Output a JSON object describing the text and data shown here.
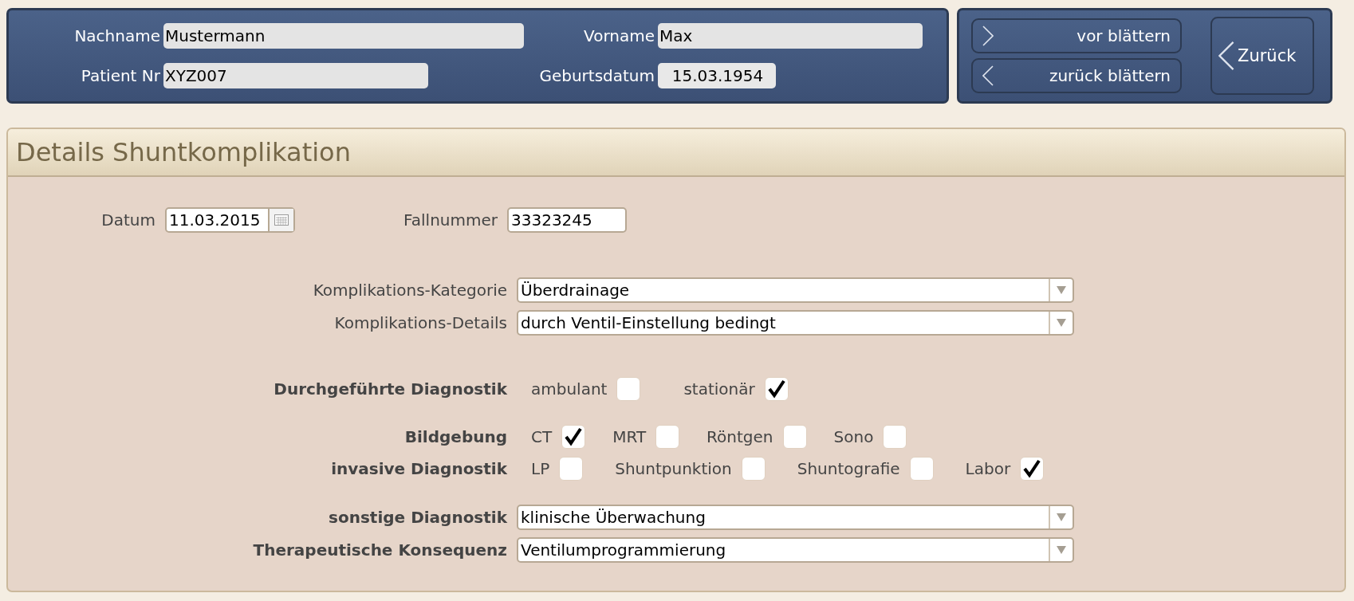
{
  "patient": {
    "fields": [
      {
        "label": "Nachname",
        "value": "Mustermann"
      },
      {
        "label": "Vorname",
        "value": "Max"
      },
      {
        "label": "Patient Nr",
        "value": "XYZ007"
      },
      {
        "label": "Geburtsdatum",
        "value": "15.03.1954"
      }
    ]
  },
  "navigation": {
    "buttons": [
      {
        "label": "vor blättern",
        "kind": "forward"
      },
      {
        "label": "zurück blättern",
        "kind": "backward"
      }
    ],
    "back": {
      "label": "Zurück",
      "kind": "backward"
    }
  },
  "section": {
    "title": "Details Shuntkomplikation",
    "date": {
      "label": "Datum",
      "value": "11.03.2015"
    },
    "case_number": {
      "label": "Fallnummer",
      "value": "33323245"
    },
    "complication_selects": [
      {
        "label": "Komplikations-Kategorie",
        "value": "Überdrainage"
      },
      {
        "label": "Komplikations-Details",
        "value": "durch Ventil-Einstellung bedingt"
      }
    ],
    "checkbox_groups": [
      {
        "label": "Durchgeführte Diagnostik",
        "options": [
          {
            "label": "ambulant",
            "checked": false
          },
          {
            "label": "stationär",
            "checked": true
          }
        ]
      },
      {
        "label": "Bildgebung",
        "options": [
          {
            "label": "CT",
            "checked": true
          },
          {
            "label": "MRT",
            "checked": false
          },
          {
            "label": "Röntgen",
            "checked": false
          },
          {
            "label": "Sono",
            "checked": false
          }
        ]
      },
      {
        "label": "invasive Diagnostik",
        "options": [
          {
            "label": "LP",
            "checked": false
          },
          {
            "label": "Shuntpunktion",
            "checked": false
          },
          {
            "label": "Shuntografie",
            "checked": false
          },
          {
            "label": "Labor",
            "checked": true
          }
        ]
      }
    ],
    "diagnostic_selects": [
      {
        "label": "sonstige Diagnostik",
        "value": "klinische Überwachung"
      },
      {
        "label": "Therapeutische Konsequenz",
        "value": "Ventilumprogrammierung"
      }
    ]
  }
}
